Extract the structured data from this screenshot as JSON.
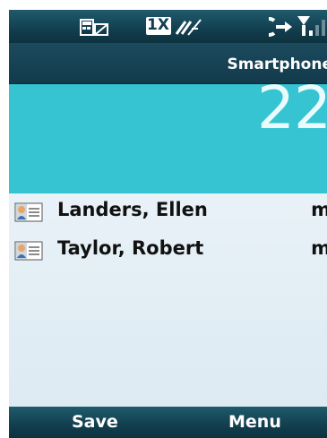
{
  "status": {
    "icons": [
      "message-icon",
      "1x-data-icon",
      "no-sync-icon",
      "key-arrow-icon",
      "signal-icon"
    ],
    "network_label": "1X"
  },
  "title": "Smartphone",
  "panel": {
    "number": "22"
  },
  "contacts": [
    {
      "name": "Landers, Ellen",
      "tag": "m"
    },
    {
      "name": "Taylor, Robert",
      "tag": "m"
    }
  ],
  "softkeys": {
    "left": "Save",
    "right": "Menu"
  },
  "colors": {
    "accent": "#36c4d2",
    "bar": "#123e4e"
  }
}
